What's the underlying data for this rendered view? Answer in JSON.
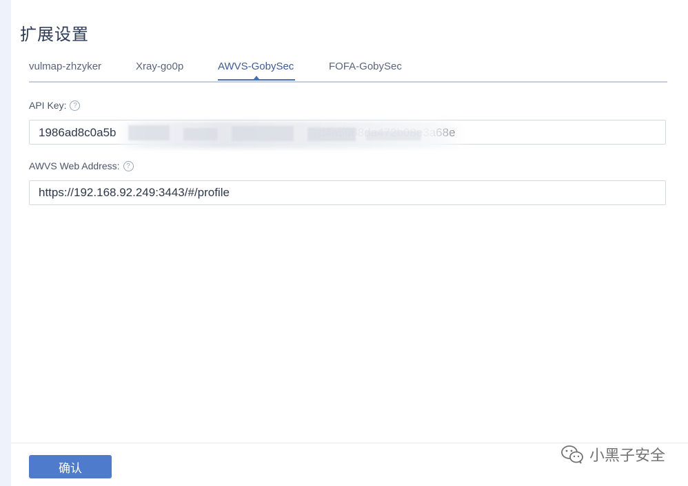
{
  "page": {
    "title": "扩展设置"
  },
  "tabs": [
    {
      "label": "vulmap-zhzyker",
      "active": false
    },
    {
      "label": "Xray-go0p",
      "active": false
    },
    {
      "label": "AWVS-GobySec",
      "active": true
    },
    {
      "label": "FOFA-GobySec",
      "active": false
    }
  ],
  "form": {
    "api_key": {
      "label": "API Key:",
      "value_prefix": "1986ad8c0a5b",
      "value_suffix": "d4a5088da472b08e3a68e"
    },
    "web_address": {
      "label": "AWVS Web Address:",
      "value": "https://192.168.92.249:3443/#/profile"
    },
    "help_glyph": "?"
  },
  "footer": {
    "confirm_label": "确认"
  },
  "watermark": {
    "text": "小黑子安全",
    "icon": "wechat-icon"
  },
  "colors": {
    "accent": "#4e7bcc",
    "tab_active": "#3c5a96",
    "sidebar_strip": "#eef2fb"
  }
}
